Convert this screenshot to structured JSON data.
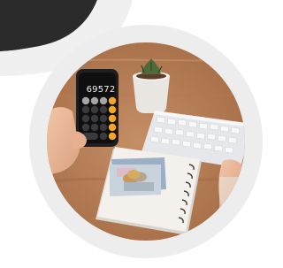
{
  "image": {
    "subject": "hand-holding-calculator-over-desk",
    "accent_colors": {
      "outer_ring": "#ededed",
      "wood_table": "#b8805a",
      "calculator_body": "#1f1f22",
      "calculator_orange_keys": "#f5a623",
      "keyboard": "#e6e7ea",
      "notebook": "#f4f1ec",
      "cash": "#9bb0c6"
    },
    "calculator_display": "69572"
  }
}
